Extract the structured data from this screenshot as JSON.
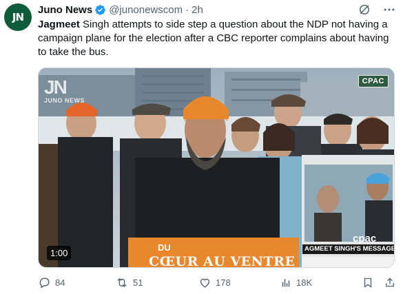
{
  "tweet": {
    "avatar_text": "JN",
    "display_name": "Juno News",
    "handle": "@junonewscom",
    "separator": "·",
    "time": "2h",
    "text_bold": "Jagmeet",
    "text_rest": " Singh attempts to side step a question about the NDP not having a campaign plane for the election after a CBC reporter complains about having to take the bus."
  },
  "media": {
    "watermark_mark": "JN",
    "watermark_word": "JUNO NEWS",
    "broadcaster_badge": "CPAC",
    "podium_line1": "DU",
    "podium_line2": "CŒUR AU VENTRE",
    "inset_logo": "cpac",
    "inset_caption": "AGMEET SINGH'S MESSAGE TO QUE",
    "duration": "1:00"
  },
  "actions": {
    "replies": "84",
    "reposts": "51",
    "likes": "178",
    "views": "18K"
  },
  "colors": {
    "avatar_bg": "#0f5b3a",
    "verified": "#1d9bf0",
    "secondary_text": "#536471",
    "podium_orange": "#e8872b"
  }
}
